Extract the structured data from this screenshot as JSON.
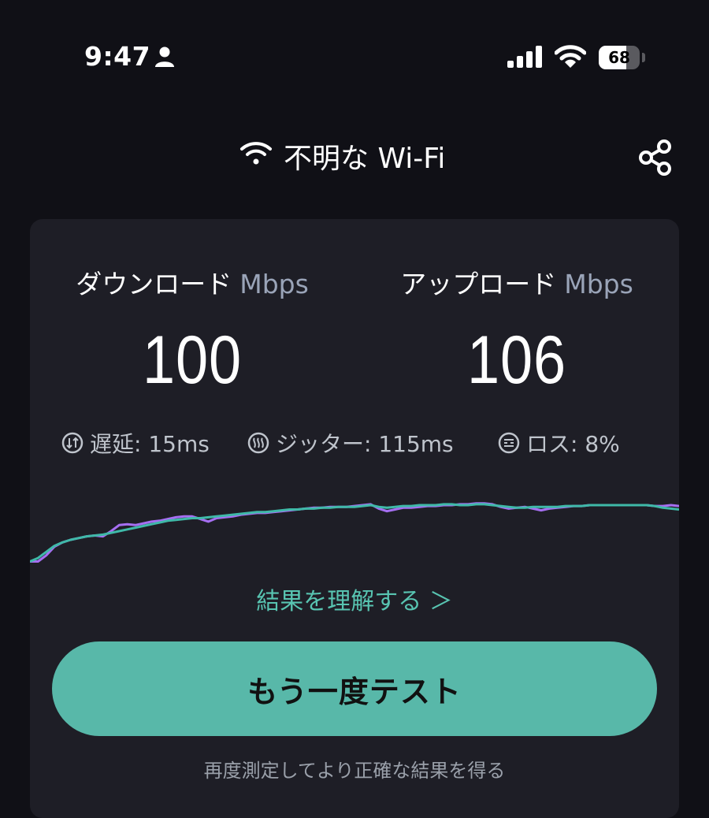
{
  "status_bar": {
    "time": "9:47",
    "battery_level": "68",
    "battery_fraction": 0.68
  },
  "header": {
    "network_name": "不明な Wi-Fi"
  },
  "results": {
    "download_label": "ダウンロード",
    "download_unit": "Mbps",
    "download_value": "100",
    "upload_label": "アップロード",
    "upload_unit": "Mbps",
    "upload_value": "106",
    "latency": "遅延: 15ms",
    "jitter": "ジッター: 115ms",
    "loss": "ロス: 8%"
  },
  "graph": {
    "series_colors": [
      "#a66ff2",
      "#3fb9a8"
    ],
    "download_series": [
      5,
      5,
      12,
      22,
      27,
      30,
      32,
      34,
      35,
      34,
      40,
      47,
      48,
      47,
      49,
      51,
      52,
      54,
      56,
      57,
      57,
      54,
      51,
      55,
      56,
      57,
      59,
      60,
      61,
      61,
      62,
      63,
      64,
      65,
      66,
      67,
      67,
      68,
      68,
      68,
      69,
      70,
      71,
      66,
      63,
      65,
      67,
      67,
      68,
      69,
      69,
      70,
      70,
      71,
      71,
      72,
      72,
      71,
      68,
      66,
      67,
      68,
      66,
      64,
      66,
      67,
      68,
      69,
      69,
      70,
      70,
      70,
      70,
      70,
      70,
      70,
      70,
      69,
      69,
      70,
      69
    ],
    "upload_series": [
      5,
      9,
      16,
      23,
      27,
      30,
      32,
      34,
      35,
      36,
      38,
      40,
      42,
      44,
      46,
      48,
      50,
      52,
      53,
      54,
      55,
      55,
      56,
      57,
      58,
      59,
      60,
      61,
      62,
      62,
      63,
      64,
      65,
      65,
      66,
      66,
      67,
      67,
      68,
      68,
      68,
      69,
      70,
      68,
      67,
      68,
      69,
      69,
      70,
      70,
      70,
      71,
      71,
      70,
      70,
      71,
      71,
      70,
      69,
      68,
      67,
      67,
      68,
      68,
      68,
      68,
      69,
      69,
      69,
      70,
      70,
      70,
      70,
      70,
      70,
      70,
      70,
      69,
      67,
      66,
      65
    ]
  },
  "actions": {
    "understand_link": "結果を理解する ＞",
    "retest_button": "もう一度テスト",
    "retest_hint": "再度測定してより正確な結果を得る"
  },
  "colors": {
    "background": "#101016",
    "card": "#1e1e26",
    "accent": "#58b8a9",
    "link": "#58c4b1"
  }
}
